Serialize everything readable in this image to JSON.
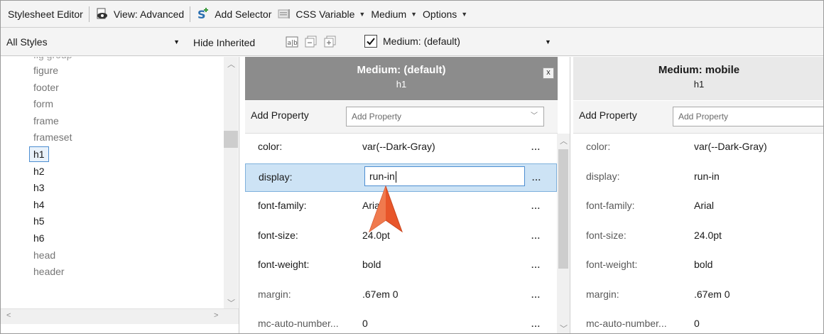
{
  "toolbar": {
    "title": "Stylesheet Editor",
    "view_label": "View: Advanced",
    "add_selector_label": "Add Selector",
    "css_variable_label": "CSS Variable",
    "medium_label": "Medium",
    "options_label": "Options"
  },
  "filterbar": {
    "styles_combo_value": "All Styles",
    "hide_inherited_label": "Hide Inherited",
    "medium_checkbox_label": "Medium: (default)",
    "medium_checked": true
  },
  "element_list": [
    {
      "label": "figure",
      "style": "gray"
    },
    {
      "label": "footer",
      "style": "gray"
    },
    {
      "label": "form",
      "style": "gray"
    },
    {
      "label": "frame",
      "style": "gray"
    },
    {
      "label": "frameset",
      "style": "gray"
    },
    {
      "label": "h1",
      "style": "selected"
    },
    {
      "label": "h2",
      "style": "dark"
    },
    {
      "label": "h3",
      "style": "dark"
    },
    {
      "label": "h4",
      "style": "dark"
    },
    {
      "label": "h5",
      "style": "dark"
    },
    {
      "label": "h6",
      "style": "dark"
    },
    {
      "label": "head",
      "style": "gray"
    },
    {
      "label": "header",
      "style": "gray"
    }
  ],
  "medium_default": {
    "title": "Medium: (default)",
    "selector": "h1",
    "close_label": "x",
    "add_property_label": "Add Property",
    "add_property_placeholder": "Add Property",
    "editing_value": "run-in",
    "properties": [
      {
        "name": "color:",
        "value": "var(--Dark-Gray)"
      },
      {
        "name": "display:",
        "value": "run-in"
      },
      {
        "name": "font-family:",
        "value": "Arial"
      },
      {
        "name": "font-size:",
        "value": "24.0pt"
      },
      {
        "name": "font-weight:",
        "value": "bold"
      },
      {
        "name": "margin:",
        "value": ".67em 0"
      },
      {
        "name": "mc-auto-number...",
        "value": "0"
      }
    ],
    "more_label": "..."
  },
  "medium_mobile": {
    "title": "Medium: mobile",
    "selector": "h1",
    "add_property_label": "Add Property",
    "add_property_placeholder": "Add Property",
    "properties": [
      {
        "name": "color:",
        "value": "var(--Dark-Gray)"
      },
      {
        "name": "display:",
        "value": "run-in"
      },
      {
        "name": "font-family:",
        "value": "Arial"
      },
      {
        "name": "font-size:",
        "value": "24.0pt"
      },
      {
        "name": "font-weight:",
        "value": "bold"
      },
      {
        "name": "margin:",
        "value": ".67em 0"
      },
      {
        "name": "mc-auto-number...",
        "value": "0"
      }
    ]
  },
  "colors": {
    "accent": "#4d8ed1",
    "header_active": "#8c8c8c",
    "row_selected": "#cde3f5",
    "cursor_orange": "#e8562a"
  }
}
